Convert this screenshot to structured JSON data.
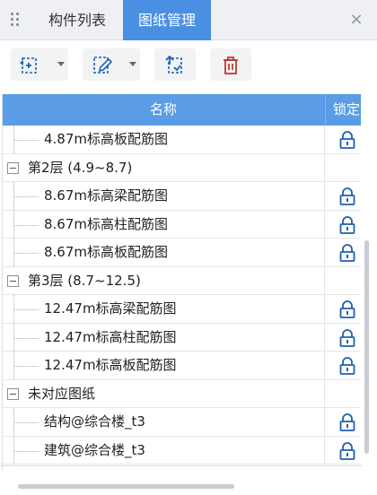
{
  "tabs": [
    {
      "label": "构件列表",
      "active": false
    },
    {
      "label": "图纸管理",
      "active": true
    }
  ],
  "close_glyph": "×",
  "colors": {
    "accent": "#4a90e2",
    "header_bg": "#5a9de6",
    "icon_blue": "#1f5fb0"
  },
  "toolbar": {
    "buttons": [
      {
        "name": "add-drawing-button",
        "icon": "add-drawing-icon",
        "has_dropdown": true
      },
      {
        "name": "edit-drawing-button",
        "icon": "edit-drawing-icon",
        "has_dropdown": true
      },
      {
        "name": "import-drawing-button",
        "icon": "import-drawing-icon",
        "has_dropdown": false
      },
      {
        "name": "delete-drawing-button",
        "icon": "trash-icon",
        "has_dropdown": false
      }
    ]
  },
  "table": {
    "columns": {
      "name": "名称",
      "lock": "锁定"
    },
    "rows": [
      {
        "type": "child",
        "label": "4.87m标高板配筋图",
        "locked": true
      },
      {
        "type": "group",
        "label": "第2层 (4.9~8.7)",
        "expanded": true
      },
      {
        "type": "child",
        "label": "8.67m标高梁配筋图",
        "locked": true
      },
      {
        "type": "child",
        "label": "8.67m标高柱配筋图",
        "locked": true
      },
      {
        "type": "child",
        "label": "8.67m标高板配筋图",
        "locked": true
      },
      {
        "type": "group",
        "label": "第3层 (8.7~12.5)",
        "expanded": true
      },
      {
        "type": "child",
        "label": "12.47m标高梁配筋图",
        "locked": true
      },
      {
        "type": "child",
        "label": "12.47m标高柱配筋图",
        "locked": true
      },
      {
        "type": "child",
        "label": "12.47m标高板配筋图",
        "locked": true
      },
      {
        "type": "group",
        "label": "未对应图纸",
        "expanded": true
      },
      {
        "type": "child",
        "label": "结构@综合楼_t3",
        "locked": true
      },
      {
        "type": "child",
        "label": "建筑@综合楼_t3",
        "locked": true
      }
    ]
  }
}
